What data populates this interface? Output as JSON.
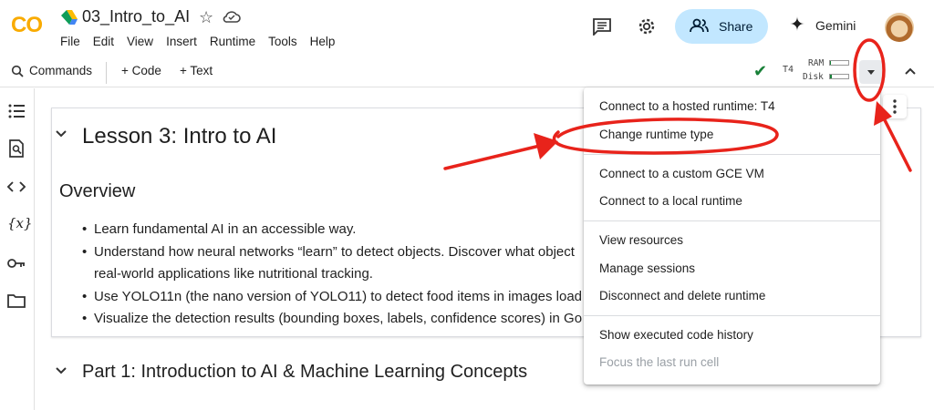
{
  "header": {
    "logo": "CO",
    "doc_title": "03_Intro_to_AI",
    "menu": [
      "File",
      "Edit",
      "View",
      "Insert",
      "Runtime",
      "Tools",
      "Help"
    ],
    "share_label": "Share",
    "gemini_label": "Gemini"
  },
  "toolbar": {
    "commands_label": "Commands",
    "add_code_label": "+ Code",
    "add_text_label": "+ Text",
    "runtime_type": "T4",
    "ram_label": "RAM",
    "disk_label": "Disk",
    "ram_usage_fraction": 0.05,
    "disk_usage_fraction": 0.1
  },
  "notebook": {
    "lesson_title": "Lesson 3: Intro to AI",
    "overview_heading": "Overview",
    "bullets": [
      "Learn fundamental AI in an accessible way.",
      "Understand how neural networks “learn” to detect objects. Discover what object",
      "real-world applications like nutritional tracking.",
      "Use YOLO11n (the nano version of YOLO11) to detect food items in images load",
      "Visualize the detection results (bounding boxes, labels, confidence scores) in Go"
    ],
    "part1_title": "Part 1: Introduction to AI & Machine Learning Concepts"
  },
  "runtime_menu": {
    "items": [
      "Connect to a hosted runtime: T4",
      "Change runtime type",
      "Connect to a custom GCE VM",
      "Connect to a local runtime",
      "View resources",
      "Manage sessions",
      "Disconnect and delete runtime",
      "Show executed code history",
      "Focus the last run cell"
    ]
  },
  "colors": {
    "share_bg": "#c2e7ff",
    "annotation_red": "#e8231b",
    "check_green": "#188038",
    "logo_orange": "#f9ab00"
  }
}
